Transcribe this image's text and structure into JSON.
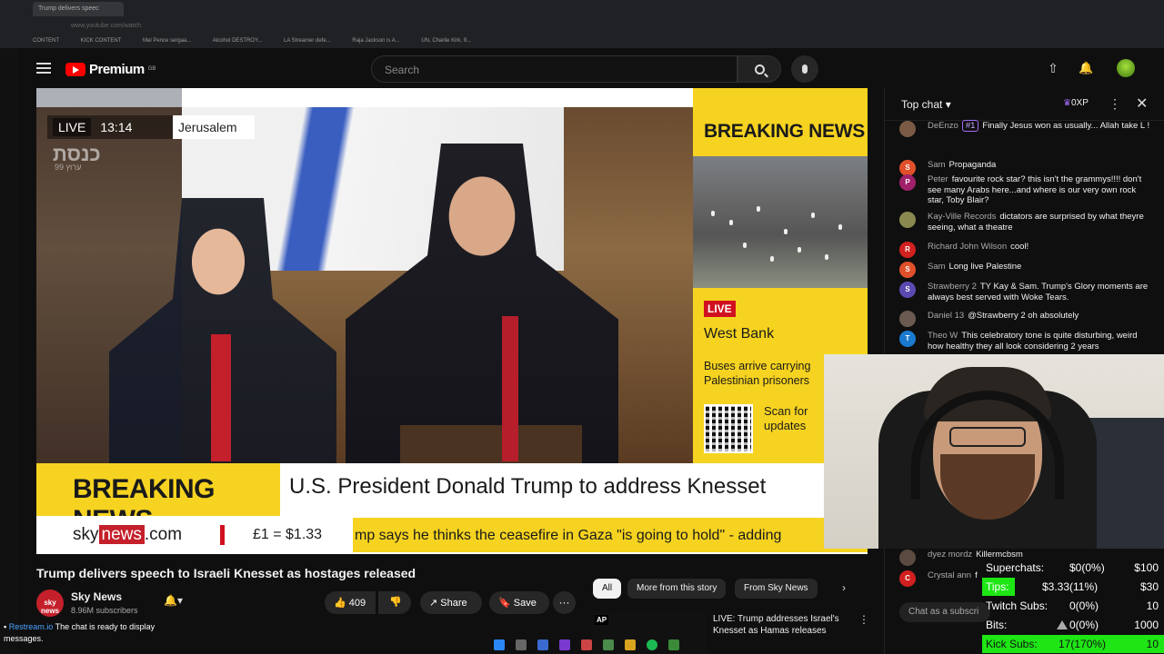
{
  "browser": {
    "tab_title": "Trump delivers speec",
    "url": "www.youtube.com/watch",
    "bookmarks": [
      "CONTENT",
      "KICK CONTENT",
      "Mel Pence sergaa...",
      "Alcohol DESTROY...",
      "LA Streamer defe...",
      "Raja Jackson is A...",
      "UN, Charlie Kirk, 9..."
    ]
  },
  "youtube": {
    "logo_text": "Premium",
    "logo_region": "GB",
    "search_placeholder": "Search"
  },
  "video": {
    "live_label": "LIVE",
    "time": "13:14",
    "location": "Jerusalem",
    "watermark_line1": "כנסת",
    "watermark_line2": "ערוץ 99",
    "right_panel": {
      "heading": "BREAKING NEWS",
      "live_label": "LIVE",
      "place": "West Bank",
      "description": "Buses arrive carrying Palestinian prisoners",
      "scan_text": "Scan for updates"
    },
    "lower_third": {
      "breaking": "BREAKING NEWS",
      "headline": "U.S. President Donald Trump to address Knesset",
      "logo_sky": "sky",
      "logo_news": "news",
      "logo_com": ".com",
      "fx": "£1 = $1.33",
      "ticker": "mp says he thinks the ceasefire in Gaza \"is going to hold\" - adding"
    }
  },
  "watch": {
    "title": "Trump delivers speech to Israeli Knesset as hostages released",
    "channel_avatar": "sky news",
    "channel_name": "Sky News",
    "subscribers": "8.96M subscribers",
    "likes": "409",
    "share_label": "Share",
    "save_label": "Save",
    "chips": [
      "All",
      "More from this story",
      "From Sky News"
    ],
    "rec_badge": "AP",
    "rec_title": "LIVE: Trump addresses Israel's Knesset as Hamas releases"
  },
  "chat": {
    "mode": "Top chat",
    "xp": "0XP",
    "input_placeholder": "Chat as a subscri",
    "messages": [
      {
        "initial": "",
        "color": "#7a5a44",
        "author": "DeEnzo",
        "badge": "#1",
        "text": "Finally Jesus won as usually... Allah take L !"
      },
      {
        "initial": "S",
        "color": "#e0502a",
        "author": "Sam",
        "badge": "",
        "text": "Propaganda"
      },
      {
        "initial": "P",
        "color": "#a0206a",
        "author": "Peter",
        "badge": "",
        "text": "favourite rock star? this isn't the grammys!!!! don't see many Arabs here...and where is our very own rock star, Toby Blair?"
      },
      {
        "initial": "",
        "color": "#8a8a50",
        "author": "Kay-Ville Records",
        "badge": "",
        "text": "dictators are surprised by what theyre seeing, what a theatre"
      },
      {
        "initial": "R",
        "color": "#d02020",
        "author": "Richard John Wilson",
        "badge": "",
        "text": "cool!"
      },
      {
        "initial": "S",
        "color": "#e0502a",
        "author": "Sam",
        "badge": "",
        "text": "Long live Palestine"
      },
      {
        "initial": "S",
        "color": "#5a4ab0",
        "author": "Strawberry 2",
        "badge": "",
        "text": "TY Kay & Sam. Trump's Glory moments are always best served with Woke Tears."
      },
      {
        "initial": "",
        "color": "#6a5a50",
        "author": "Daniel 13",
        "badge": "",
        "text": "@Strawberry 2 oh absolutely"
      },
      {
        "initial": "T",
        "color": "#1a7ad0",
        "author": "Theo W",
        "badge": "",
        "text": "This celebratory tone is quite disturbing, weird how healthy they all look considering 2 years"
      },
      {
        "initial": "",
        "color": "#5a4a40",
        "author": "dyez mordz",
        "badge": "",
        "text": "Killermcbsm"
      },
      {
        "initial": "C",
        "color": "#d02020",
        "author": "Crystal ann",
        "badge": "",
        "text": "f"
      }
    ]
  },
  "overlay": {
    "stats": [
      {
        "label": "Superchats:",
        "value": "$0(0%)",
        "goal": "$100"
      },
      {
        "label": "Tips:",
        "value": "$3.33(11%)",
        "goal": "$30"
      },
      {
        "label": "Twitch Subs:",
        "value": "0(0%)",
        "goal": "10"
      },
      {
        "label": "Bits:",
        "value": "0(0%)",
        "goal": "1000"
      },
      {
        "label": "Kick Subs:",
        "value": "17(170%)",
        "goal": "10"
      }
    ],
    "tips_progress": 0.11,
    "restream_brand": "Restream.io",
    "restream_message": "The chat is ready to display messages."
  },
  "colors": {
    "sky_yellow": "#f6d320",
    "youtube_red": "#ff0000",
    "kick_green": "#1ee615"
  }
}
